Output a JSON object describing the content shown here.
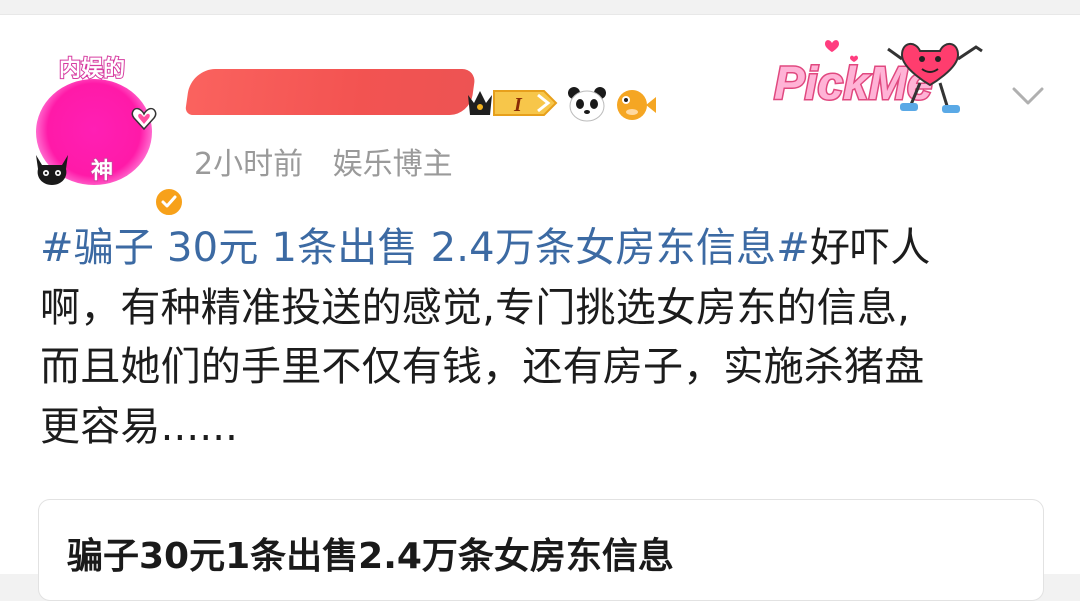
{
  "author": {
    "avatar_top_text": "内娱的",
    "avatar_bottom_text": "神",
    "verified": true
  },
  "post": {
    "time": "2小时前",
    "category": "娱乐博主",
    "level_badge": "I",
    "topic": "#骗子 30元 1条出售 2.4万条女房东信息#",
    "lines": [
      "好吓人",
      "啊，有种精准投送的感觉,专门挑选女房东的信息,",
      "而且她们的手里不仅有钱，还有房子，实施杀猪盘",
      "更容易......"
    ]
  },
  "sticker": {
    "text": "PickMe"
  },
  "linked_card": {
    "title": "骗子30元1条出售2.4万条女房东信息"
  },
  "colors": {
    "topic_link": "#3c6aa3",
    "meta_text": "#9a9a9a",
    "body_text": "#1c1c1c",
    "avatar_pink": "#ff1aa8",
    "verified_orange": "#f7a11a",
    "redaction_red": "#f24a48"
  }
}
